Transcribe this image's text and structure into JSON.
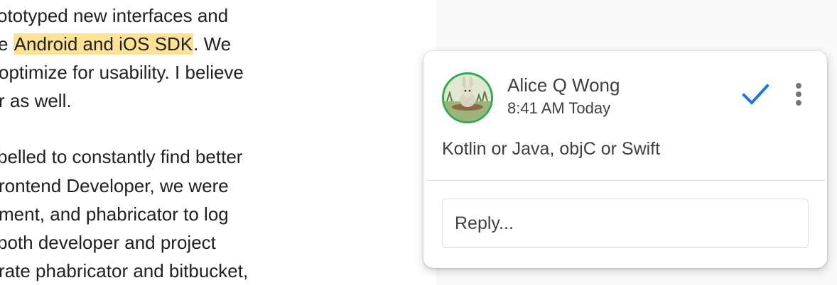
{
  "document": {
    "lines": [
      {
        "before": "ototyped new interfaces and",
        "highlight": "",
        "after": ""
      },
      {
        "before": "e ",
        "highlight": "Android and iOS SDK",
        "after": ". We"
      },
      {
        "before": " optimize for usability. I believe",
        "highlight": "",
        "after": ""
      },
      {
        "before": "r as well.",
        "highlight": "",
        "after": ""
      },
      {
        "before": "belled to constantly find better",
        "highlight": "",
        "after": ""
      },
      {
        "before": "rontend Developer, we were",
        "highlight": "",
        "after": ""
      },
      {
        "before": "ment, and phabricator to log",
        "highlight": "",
        "after": ""
      },
      {
        "before": "both developer and project",
        "highlight": "",
        "after": ""
      },
      {
        "before": "rate phabricator and bitbucket,",
        "highlight": "",
        "after": ""
      }
    ],
    "highlight_color": "#fde293"
  },
  "comment": {
    "author": "Alice Q Wong",
    "timestamp": "8:41 AM Today",
    "text": "Kotlin or Java, objC or Swift",
    "avatar_ring_color": "#34a853",
    "resolve_icon": "checkmark-icon",
    "resolve_color": "#1a73e8",
    "more_icon": "more-vert-icon",
    "reply_placeholder": "Reply..."
  }
}
